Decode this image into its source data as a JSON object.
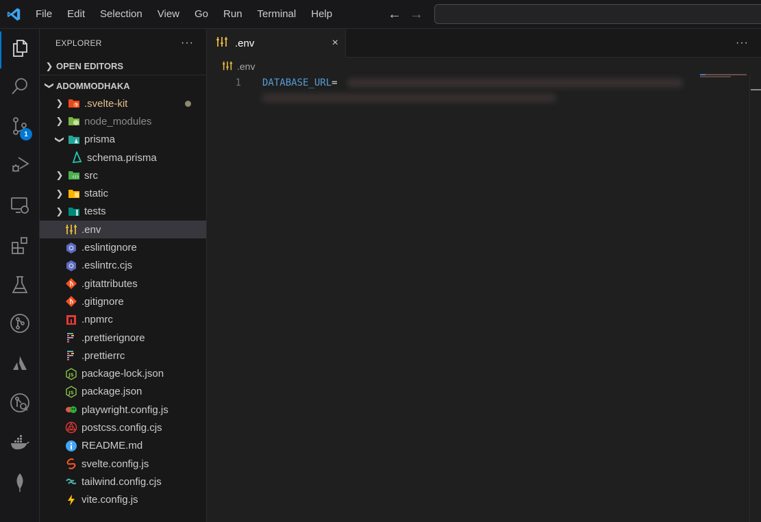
{
  "titlebar": {
    "app_icon": "vscode-logo-icon",
    "menu": [
      "File",
      "Edit",
      "Selection",
      "View",
      "Go",
      "Run",
      "Terminal",
      "Help"
    ],
    "nav_back": "←",
    "nav_forward": "→",
    "command_center_placeholder": ""
  },
  "activitybar": {
    "items": [
      {
        "name": "explorer",
        "icon": "files-icon",
        "active": true
      },
      {
        "name": "search",
        "icon": "search-icon"
      },
      {
        "name": "source-control",
        "icon": "source-control-icon",
        "badge": "1"
      },
      {
        "name": "run-debug",
        "icon": "run-debug-icon"
      },
      {
        "name": "remote-explorer",
        "icon": "remote-explorer-icon"
      },
      {
        "name": "extensions",
        "icon": "extensions-icon"
      },
      {
        "name": "testing",
        "icon": "flask-icon"
      },
      {
        "name": "git-graph",
        "icon": "git-graph-icon"
      },
      {
        "name": "atlassian",
        "icon": "atlassian-icon"
      },
      {
        "name": "gitlens",
        "icon": "gitlens-inspect-icon"
      },
      {
        "name": "docker",
        "icon": "docker-icon"
      },
      {
        "name": "mongodb",
        "icon": "leaf-icon"
      }
    ]
  },
  "sidebar": {
    "title": "EXPLORER",
    "more": "···",
    "open_editors_label": "OPEN EDITORS",
    "project_label": "ADOMMODHAKA",
    "tree": [
      {
        "label": ".svelte-kit",
        "type": "folder",
        "expanded": false,
        "icon": "svelte-folder-icon",
        "color": "#e2c08d",
        "modified": true
      },
      {
        "label": "node_modules",
        "type": "folder",
        "expanded": false,
        "icon": "node-folder-icon",
        "dim": true
      },
      {
        "label": "prisma",
        "type": "folder",
        "expanded": true,
        "icon": "prisma-folder-icon"
      },
      {
        "label": "schema.prisma",
        "type": "file",
        "indent": 2,
        "icon": "prisma-icon"
      },
      {
        "label": "src",
        "type": "folder",
        "expanded": false,
        "icon": "src-folder-icon"
      },
      {
        "label": "static",
        "type": "folder",
        "expanded": false,
        "icon": "static-folder-icon"
      },
      {
        "label": "tests",
        "type": "folder",
        "expanded": false,
        "icon": "tests-folder-icon"
      },
      {
        "label": ".env",
        "type": "file",
        "icon": "env-icon",
        "selected": true
      },
      {
        "label": ".eslintignore",
        "type": "file",
        "icon": "eslint-icon"
      },
      {
        "label": ".eslintrc.cjs",
        "type": "file",
        "icon": "eslint-icon"
      },
      {
        "label": ".gitattributes",
        "type": "file",
        "icon": "git-icon"
      },
      {
        "label": ".gitignore",
        "type": "file",
        "icon": "git-icon"
      },
      {
        "label": ".npmrc",
        "type": "file",
        "icon": "npm-icon"
      },
      {
        "label": ".prettierignore",
        "type": "file",
        "icon": "prettier-icon"
      },
      {
        "label": ".prettierrc",
        "type": "file",
        "icon": "prettier-icon"
      },
      {
        "label": "package-lock.json",
        "type": "file",
        "icon": "nodejs-icon"
      },
      {
        "label": "package.json",
        "type": "file",
        "icon": "nodejs-icon"
      },
      {
        "label": "playwright.config.js",
        "type": "file",
        "icon": "playwright-icon"
      },
      {
        "label": "postcss.config.cjs",
        "type": "file",
        "icon": "postcss-icon"
      },
      {
        "label": "README.md",
        "type": "file",
        "icon": "info-icon"
      },
      {
        "label": "svelte.config.js",
        "type": "file",
        "icon": "svelte-icon"
      },
      {
        "label": "tailwind.config.cjs",
        "type": "file",
        "icon": "tailwind-icon"
      },
      {
        "label": "vite.config.js",
        "type": "file",
        "icon": "vite-icon"
      }
    ]
  },
  "editor": {
    "tab": {
      "label": ".env",
      "close": "×"
    },
    "tab_actions": "···",
    "breadcrumb": ".env",
    "lines": [
      {
        "number": "1",
        "key": "DATABASE_URL",
        "eq": "=",
        "value_redacted": true
      }
    ]
  }
}
